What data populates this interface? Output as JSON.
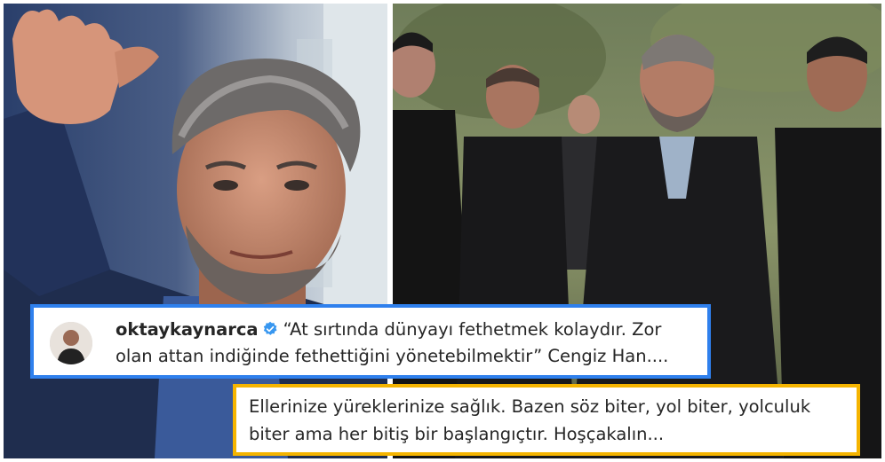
{
  "post": {
    "username": "oktaykaynarca",
    "quote": "“At sırtında dünyayı fethetmek kolaydır. Zor olan attan indiğinde fethettiğini yönetebilmektir” Cengiz Han...."
  },
  "reply": {
    "text": "Ellerinize yüreklerinize sağlık. Bazen söz biter, yol biter, yolculuk biter ama her bitiş bir başlangıçtır. Hoşçakalın..."
  },
  "colors": {
    "post_border": "#2f80ed",
    "reply_border": "#f5b400",
    "verified_badge": "#3897f0"
  },
  "icons": {
    "verified": "verified-badge-icon"
  }
}
